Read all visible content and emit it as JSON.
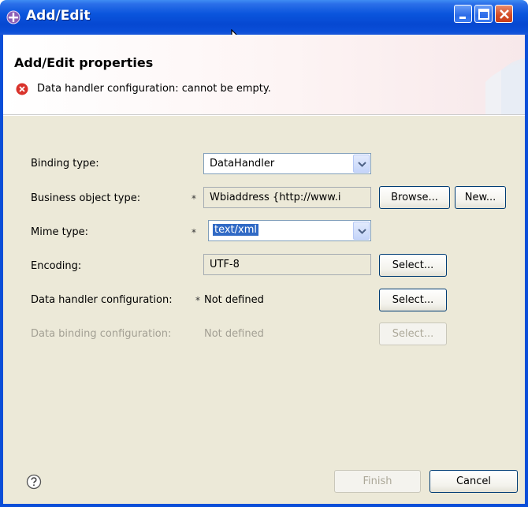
{
  "window": {
    "title": "Add/Edit"
  },
  "header": {
    "title": "Add/Edit properties",
    "error_message": "Data handler configuration: cannot be empty."
  },
  "form": {
    "binding_type": {
      "label": "Binding type:",
      "value": "DataHandler"
    },
    "business_object_type": {
      "label": "Business object type:",
      "required": "*",
      "value": "Wbiaddress {http://www.i",
      "browse_label": "Browse...",
      "new_label": "New..."
    },
    "mime_type": {
      "label": "Mime type:",
      "required": "*",
      "value": "text/xml"
    },
    "encoding": {
      "label": "Encoding:",
      "value": "UTF-8",
      "select_label": "Select..."
    },
    "data_handler_configuration": {
      "label": "Data handler configuration:",
      "required": "*",
      "value": "Not defined",
      "select_label": "Select..."
    },
    "data_binding_configuration": {
      "label": "Data binding configuration:",
      "value": "Not defined",
      "select_label": "Select..."
    }
  },
  "footer": {
    "finish_label": "Finish",
    "cancel_label": "Cancel"
  },
  "icons": {
    "app": "eclipse-plugin-icon",
    "error": "error-icon",
    "help": "help-icon",
    "cursor": "mouse-pointer-icon"
  },
  "colors": {
    "titlebar": "#0a55dd",
    "error": "#d9322b",
    "selection": "#316ac5",
    "dialog_bg": "#ece9d8"
  }
}
